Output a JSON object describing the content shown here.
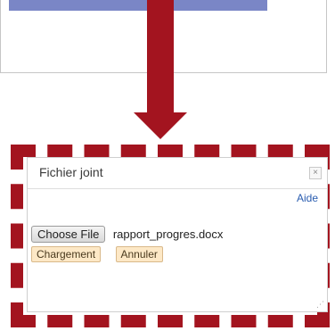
{
  "dialog": {
    "title": "Fichier joint",
    "close_label": "×",
    "help_link": "Aide",
    "choose_file_label": "Choose File",
    "selected_file": "rapport_progres.docx",
    "upload_button": "Chargement",
    "cancel_button": "Annuler",
    "resize_glyph": "⋰"
  },
  "colors": {
    "arrow": "#a3141f",
    "frame_dash": "#a3141f",
    "top_bar": "#7a86c6",
    "help_link": "#2a5db0",
    "tan_button": "#fde8c6"
  },
  "icons": [
    "close-icon",
    "resize-grip-icon",
    "down-arrow-icon"
  ]
}
